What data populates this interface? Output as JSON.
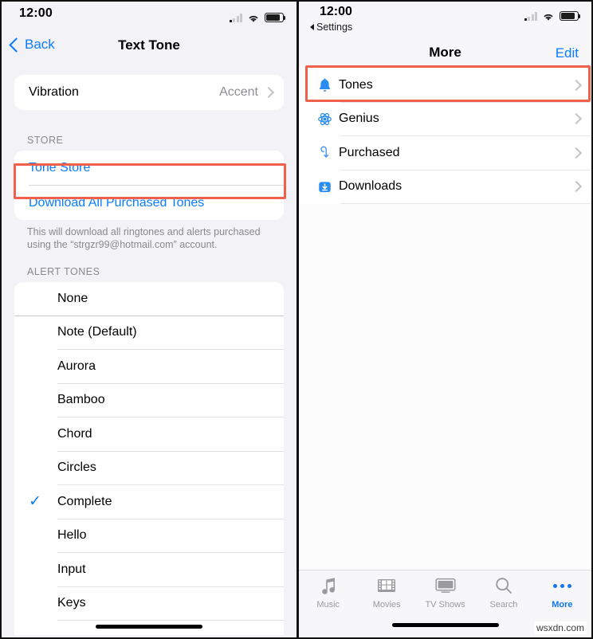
{
  "left": {
    "status": {
      "time": "12:00",
      "signal_icon": "cellular-bars-icon",
      "wifi_icon": "wifi-icon",
      "battery_icon": "battery-icon"
    },
    "nav": {
      "back_label": "Back",
      "title": "Text Tone"
    },
    "vibration_row": {
      "label": "Vibration",
      "value": "Accent"
    },
    "store": {
      "header": "STORE",
      "tone_store_label": "Tone Store",
      "download_all_label": "Download All Purchased Tones",
      "footnote": "This will download all ringtones and alerts purchased using the “strgzr99@hotmail.com” account."
    },
    "alert_tones": {
      "header": "ALERT TONES",
      "selected": "Complete",
      "items": [
        {
          "name": "None",
          "checked": false
        },
        {
          "name": "Note (Default)",
          "checked": false
        },
        {
          "name": "Aurora",
          "checked": false
        },
        {
          "name": "Bamboo",
          "checked": false
        },
        {
          "name": "Chord",
          "checked": false
        },
        {
          "name": "Circles",
          "checked": false
        },
        {
          "name": "Complete",
          "checked": true
        },
        {
          "name": "Hello",
          "checked": false
        },
        {
          "name": "Input",
          "checked": false
        },
        {
          "name": "Keys",
          "checked": false
        }
      ],
      "check_glyph": "✓"
    },
    "annotation": {
      "color": "#f0604d",
      "target": "Tone Store"
    }
  },
  "right": {
    "status": {
      "time": "12:00",
      "back_label": "Settings",
      "signal_icon": "cellular-bars-icon",
      "wifi_icon": "wifi-icon",
      "battery_icon": "battery-icon"
    },
    "nav": {
      "title": "More",
      "edit_label": "Edit"
    },
    "items": [
      {
        "label": "Tones",
        "icon": "bell-icon",
        "highlighted": true
      },
      {
        "label": "Genius",
        "icon": "atom-icon",
        "highlighted": false
      },
      {
        "label": "Purchased",
        "icon": "purchased-loop-icon",
        "highlighted": false
      },
      {
        "label": "Downloads",
        "icon": "download-box-icon",
        "highlighted": false
      }
    ],
    "tabbar": [
      {
        "label": "Music",
        "icon": "music-note-icon",
        "active": false
      },
      {
        "label": "Movies",
        "icon": "film-icon",
        "active": false
      },
      {
        "label": "TV Shows",
        "icon": "tv-icon",
        "active": false
      },
      {
        "label": "Search",
        "icon": "search-icon",
        "active": false
      },
      {
        "label": "More",
        "icon": "ellipsis-icon",
        "active": true
      }
    ],
    "annotation": {
      "color": "#f0604d",
      "target": "Tones"
    }
  },
  "watermark": "wsxdn.com"
}
